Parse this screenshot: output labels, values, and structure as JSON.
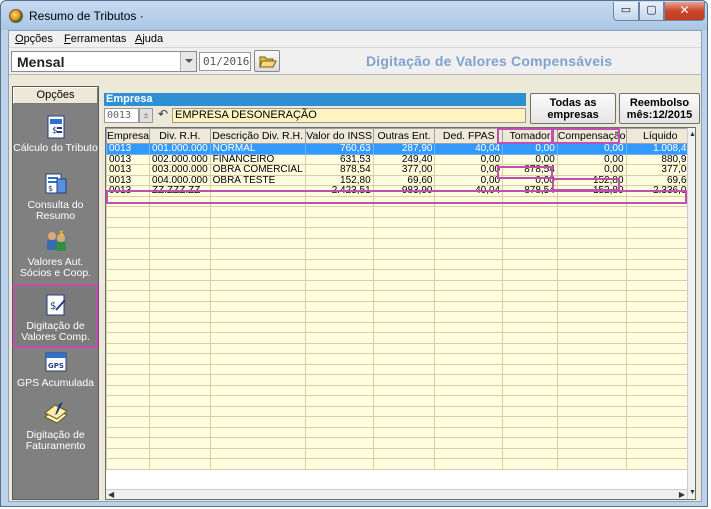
{
  "window": {
    "title": "Resumo de Tributos ·",
    "min_label": "▭",
    "max_label": "▢",
    "close_label": "✕"
  },
  "menu": [
    {
      "label": "Opções"
    },
    {
      "label": "Ferramentas"
    },
    {
      "label": "Ajuda"
    }
  ],
  "toolbar": {
    "period": "Mensal",
    "date": "01/2016",
    "screen_title": "Digitação de Valores Compensáveis"
  },
  "sidebar": {
    "header": "Opções",
    "items": [
      {
        "label": "Cálculo do Tributo",
        "icon": "calculator-doc-icon"
      },
      {
        "label": "Consulta do Resumo",
        "icon": "document-search-icon"
      },
      {
        "label": "Valores Aut. Sócios e Coop.",
        "icon": "people-money-icon"
      },
      {
        "label": "Digitação de Valores Comp.",
        "icon": "document-edit-icon"
      },
      {
        "label": "GPS Acumulada",
        "icon": "gps-icon"
      },
      {
        "label": "Digitação de Faturamento",
        "icon": "stack-papers-icon"
      }
    ]
  },
  "empresa": {
    "label": "Empresa",
    "code": "0013",
    "spin": "±",
    "undo": "↶",
    "name": "EMPRESA DESONERAÇÃO"
  },
  "buttons": {
    "todas": "Todas as empresas",
    "reembolso": "Reembolso mês:12/2015"
  },
  "table": {
    "columns": [
      "Empresa",
      "Div. R.H.",
      "Descrição Div. R.H.",
      "Valor do INSS",
      "Outras Ent.",
      "Ded. FPAS",
      "Tomador",
      "Compensação",
      "Líquido"
    ],
    "rows": [
      [
        "0013",
        "001.000.000",
        "NORMAL",
        "760,63",
        "287,90",
        "40,04",
        "0,00",
        "0,00",
        "1.008,49"
      ],
      [
        "0013",
        "002.000.000",
        "FINANCEIRO",
        "631,53",
        "249,40",
        "0,00",
        "0,00",
        "0,00",
        "880,93"
      ],
      [
        "0013",
        "003.000.000",
        "OBRA COMERCIAL",
        "878,54",
        "377,00",
        "0,00",
        "878,54",
        "0,00",
        "377,00"
      ],
      [
        "0013",
        "004.000.000",
        "OBRA TESTE",
        "152,80",
        "69,60",
        "0,00",
        "0,00",
        "152,80",
        "69,60"
      ]
    ],
    "total": [
      "0013",
      "ZZ.ZZZ.ZZ",
      "",
      "2.423,51",
      "983,90",
      "40,04",
      "878,54",
      "152,80",
      "2.336,03"
    ]
  },
  "colors": {
    "highlight": "#c050b0",
    "selection": "#3399ff",
    "title_accent": "#7fa3cf"
  }
}
